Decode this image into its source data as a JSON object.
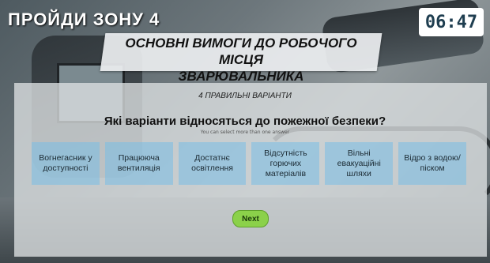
{
  "header": {
    "zone_title": "ПРОЙДИ ЗОНУ 4",
    "timer": "06:47"
  },
  "banner": {
    "line1": "ОСНОВНІ ВИМОГИ ДО РОБОЧОГО МІСЦЯ",
    "line2": "ЗВАРЮВАЛЬНИКА"
  },
  "quiz": {
    "count_label": "4 ПРАВИЛЬНІ ВАРІАНТИ",
    "question": "Які варіанти відносяться до пожежної безпеки?",
    "hint": "You can select more than one answer",
    "options": [
      {
        "label": "Вогнегасник у доступності"
      },
      {
        "label": "Працююча вентиляція"
      },
      {
        "label": "Достатнє освітлення"
      },
      {
        "label": "Відсутність горючих матеріалів"
      },
      {
        "label": "Вільні евакуаційні шляхи"
      },
      {
        "label": "Відро з водою/піском"
      }
    ],
    "next_label": "Next"
  },
  "colors": {
    "option_fill": "#78bee6",
    "next_button": "#8bd14a",
    "timer_text": "#1f3e50"
  }
}
